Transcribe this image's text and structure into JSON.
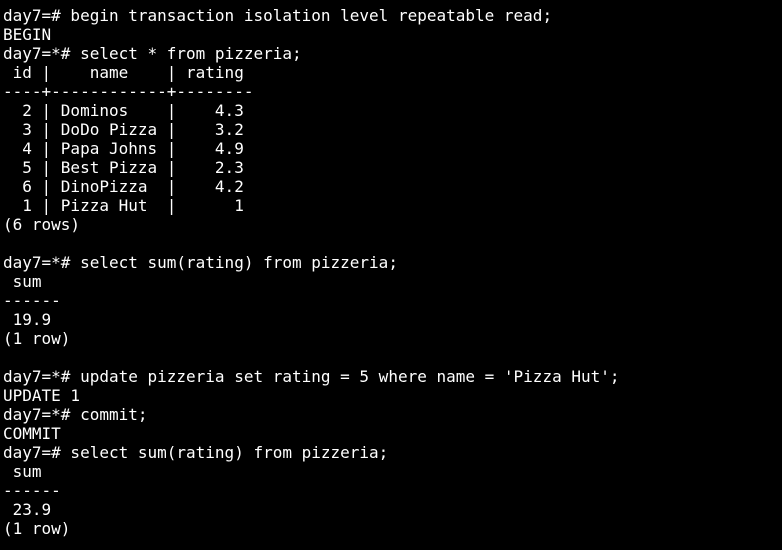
{
  "colors": {
    "background": "#000000",
    "foreground": "#ffffff"
  },
  "terminal": {
    "lines": [
      "day7=# begin transaction isolation level repeatable read;",
      "BEGIN",
      "day7=*# select * from pizzeria;",
      " id |    name    | rating",
      "----+------------+--------",
      "  2 | Dominos    |    4.3",
      "  3 | DoDo Pizza |    3.2",
      "  4 | Papa Johns |    4.9",
      "  5 | Best Pizza |    2.3",
      "  6 | DinoPizza  |    4.2",
      "  1 | Pizza Hut  |      1",
      "(6 rows)",
      "",
      "day7=*# select sum(rating) from pizzeria;",
      " sum",
      "------",
      " 19.9",
      "(1 row)",
      "",
      "day7=*# update pizzeria set rating = 5 where name = 'Pizza Hut';",
      "UPDATE 1",
      "day7=*# commit;",
      "COMMIT",
      "day7=# select sum(rating) from pizzeria;",
      " sum",
      "------",
      " 23.9",
      "(1 row)"
    ]
  }
}
